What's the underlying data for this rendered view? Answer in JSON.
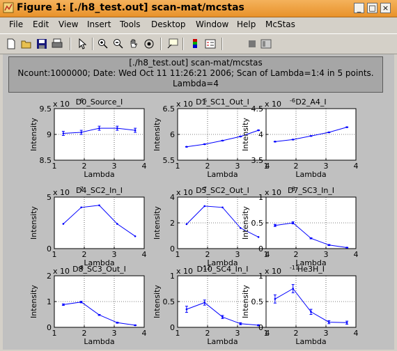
{
  "window": {
    "title": "Figure 1: [./h8_test.out] scan-mat/mcstas",
    "buttons": [
      "_",
      "□",
      "×"
    ]
  },
  "menu": {
    "items": [
      "File",
      "Edit",
      "View",
      "Insert",
      "Tools",
      "Desktop",
      "Window",
      "Help",
      "McStas"
    ],
    "grip": "↘"
  },
  "toolbar": {
    "icons": [
      "new-icon",
      "open-icon",
      "save-icon",
      "print-icon",
      "arrow-icon",
      "zoom-in-icon",
      "zoom-out-icon",
      "pan-icon",
      "rotate-icon",
      "data-cursor-icon",
      "colorbar-icon",
      "legend-icon",
      "hide-plot-tools-icon",
      "show-plot-tools-icon"
    ]
  },
  "header": {
    "line1": "[./h8_test.out] scan-mat/mcstas",
    "line2": "Ncount:1000000; Date: Wed Oct 11 11:26:21 2006; Scan of Lambda=1:4 in 5 points.",
    "line3": "Lambda=4"
  },
  "chart_data": [
    {
      "type": "line",
      "title": "D0_Source_I",
      "exponent": "x 10",
      "exp_power": "-6",
      "xlabel": "Lambda",
      "ylabel": "Intensity",
      "xlim": [
        1,
        4
      ],
      "ylim": [
        8.5,
        9.5
      ],
      "xticks": [
        "1",
        "2",
        "3",
        "4"
      ],
      "yticks": [
        "8.5",
        "9",
        "9.5"
      ],
      "x": [
        1.3,
        1.9,
        2.5,
        3.1,
        3.7
      ],
      "y": [
        9.02,
        9.04,
        9.12,
        9.12,
        9.08
      ],
      "err": [
        0.04,
        0.04,
        0.04,
        0.04,
        0.04
      ],
      "color": "#0000ff"
    },
    {
      "type": "line",
      "title": "D1_SC1_Out_I",
      "exponent": "x 10",
      "exp_power": "-6",
      "xlabel": "Lambda",
      "ylabel": "Intensity",
      "xlim": [
        1,
        4
      ],
      "ylim": [
        5.5,
        6.5
      ],
      "xticks": [
        "1",
        "2",
        "3",
        "4"
      ],
      "yticks": [
        "5.5",
        "6",
        "6.5"
      ],
      "x": [
        1.3,
        1.9,
        2.5,
        3.1,
        3.7
      ],
      "y": [
        5.76,
        5.81,
        5.88,
        5.96,
        6.08
      ],
      "err": [
        0.005,
        0.005,
        0.005,
        0.005,
        0.005
      ],
      "color": "#0000ff"
    },
    {
      "type": "line",
      "title": "D2_A4_I",
      "exponent": "x 10",
      "exp_power": "-6",
      "xlabel": "Lambda",
      "ylabel": "Intensity",
      "xlim": [
        1,
        4
      ],
      "ylim": [
        3.5,
        4.5
      ],
      "xticks": [
        "1",
        "2",
        "3",
        "4"
      ],
      "yticks": [
        "3.5",
        "4",
        "4.5"
      ],
      "x": [
        1.3,
        1.9,
        2.5,
        3.1,
        3.7
      ],
      "y": [
        3.86,
        3.9,
        3.97,
        4.04,
        4.14
      ],
      "err": [
        0.005,
        0.005,
        0.005,
        0.005,
        0.005
      ],
      "color": "#0000ff"
    },
    {
      "type": "line",
      "title": "D4_SC2_In_I",
      "exponent": "x 10",
      "exp_power": "-7",
      "xlabel": "Lambda",
      "ylabel": "Intensity",
      "xlim": [
        1,
        4
      ],
      "ylim": [
        0,
        5
      ],
      "xticks": [
        "1",
        "2",
        "3",
        "4"
      ],
      "yticks": [
        "0",
        "5"
      ],
      "x": [
        1.3,
        1.9,
        2.5,
        3.1,
        3.7
      ],
      "y": [
        2.4,
        4.0,
        4.2,
        2.4,
        1.2
      ],
      "err": [
        0,
        0,
        0,
        0,
        0
      ],
      "color": "#0000ff"
    },
    {
      "type": "line",
      "title": "D5_SC2_Out_I",
      "exponent": "x 10",
      "exp_power": "-7",
      "xlabel": "Lambda",
      "ylabel": "Intensity",
      "xlim": [
        1,
        4
      ],
      "ylim": [
        0,
        4
      ],
      "xticks": [
        "1",
        "2",
        "3",
        "4"
      ],
      "yticks": [
        "0",
        "2",
        "4"
      ],
      "x": [
        1.3,
        1.9,
        2.5,
        3.1,
        3.7
      ],
      "y": [
        1.9,
        3.3,
        3.2,
        1.6,
        0.9
      ],
      "err": [
        0,
        0,
        0,
        0,
        0
      ],
      "color": "#0000ff"
    },
    {
      "type": "line",
      "title": "D7_SC3_In_I",
      "exponent": "x 10",
      "exp_power": "-8",
      "xlabel": "Lambda",
      "ylabel": "Intensity",
      "xlim": [
        1,
        4
      ],
      "ylim": [
        0,
        1
      ],
      "xticks": [
        "1",
        "2",
        "3",
        "4"
      ],
      "yticks": [
        "0",
        "0.5",
        "1"
      ],
      "x": [
        1.3,
        1.9,
        2.5,
        3.1,
        3.7
      ],
      "y": [
        0.45,
        0.5,
        0.2,
        0.07,
        0.02
      ],
      "err": [
        0.02,
        0.02,
        0.01,
        0.01,
        0.005
      ],
      "color": "#0000ff"
    },
    {
      "type": "line",
      "title": "D8_SC3_Out_I",
      "exponent": "x 10",
      "exp_power": "-8",
      "xlabel": "Lambda",
      "ylabel": "Intensity",
      "xlim": [
        1,
        4
      ],
      "ylim": [
        0,
        2
      ],
      "xticks": [
        "1",
        "2",
        "3",
        "4"
      ],
      "yticks": [
        "0",
        "1",
        "2"
      ],
      "x": [
        1.3,
        1.9,
        2.5,
        3.1,
        3.7
      ],
      "y": [
        0.88,
        0.98,
        0.48,
        0.18,
        0.08
      ],
      "err": [
        0.03,
        0.03,
        0.02,
        0.02,
        0.01
      ],
      "color": "#0000ff"
    },
    {
      "type": "line",
      "title": "D10_SC4_In_I",
      "exponent": "x 10",
      "exp_power": "-12",
      "xlabel": "Lambda",
      "ylabel": "Intensity",
      "xlim": [
        1,
        4
      ],
      "ylim": [
        0,
        1
      ],
      "xticks": [
        "1",
        "2",
        "3",
        "4"
      ],
      "yticks": [
        "0",
        "0.5",
        "1"
      ],
      "x": [
        1.3,
        1.9,
        2.5,
        3.1,
        3.7
      ],
      "y": [
        0.35,
        0.48,
        0.2,
        0.07,
        0.04
      ],
      "err": [
        0.06,
        0.05,
        0.03,
        0.02,
        0.01
      ],
      "color": "#0000ff"
    },
    {
      "type": "line",
      "title": "He3H_I",
      "exponent": "x 10",
      "exp_power": "-11",
      "xlabel": "Lambda",
      "ylabel": "Intensity",
      "xlim": [
        1,
        4
      ],
      "ylim": [
        0,
        1
      ],
      "xticks": [
        "1",
        "2",
        "3",
        "4"
      ],
      "yticks": [
        "0",
        "0.5",
        "1"
      ],
      "x": [
        1.3,
        1.9,
        2.5,
        3.1,
        3.7
      ],
      "y": [
        0.55,
        0.75,
        0.3,
        0.1,
        0.09
      ],
      "err": [
        0.08,
        0.08,
        0.05,
        0.03,
        0.03
      ],
      "color": "#0000ff"
    }
  ]
}
